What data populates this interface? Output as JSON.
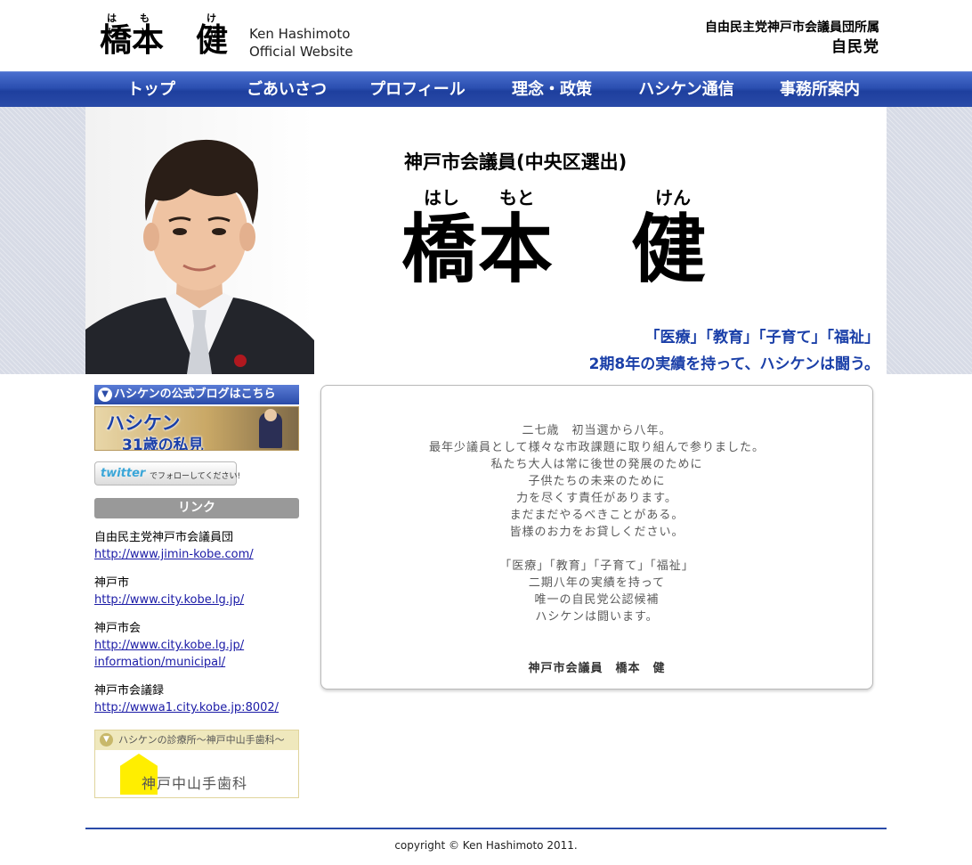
{
  "header": {
    "ruby": [
      "はし",
      "もと",
      "けん"
    ],
    "name": "橋本　健",
    "en_line1": "Ken Hashimoto",
    "en_line2": "Official Website",
    "affiliation": "自由民主党神戸市会議員団所属",
    "party": "自民党"
  },
  "nav": {
    "items": [
      {
        "label": "トップ"
      },
      {
        "label": "ごあいさつ"
      },
      {
        "label": "プロフィール"
      },
      {
        "label": "理念・政策"
      },
      {
        "label": "ハシケン通信"
      },
      {
        "label": "事務所案内"
      }
    ]
  },
  "hero": {
    "subtitle": "神戸市会議員(中央区選出)",
    "ruby": [
      "はし",
      "もと",
      "けん"
    ],
    "name": "橋本　健",
    "slogan1": "「医療」「教育」「子育て」「福祉」",
    "slogan2": "2期8年の実績を持って、ハシケンは闘う。"
  },
  "sidebar": {
    "blog_bar": "ハシケンの公式ブログはこちら",
    "blog_banner_line1": "ハシケン",
    "blog_banner_line2": "31歳の私見",
    "twitter_logo": "twitter",
    "twitter_follow": "でフォローしてください!",
    "links_heading": "リンク",
    "links": [
      {
        "name": "自由民主党神戸市会議員団",
        "url": "http://www.jimin-kobe.com/"
      },
      {
        "name": "神戸市",
        "url": "http://www.city.kobe.lg.jp/"
      },
      {
        "name": "神戸市会",
        "url": "http://www.city.kobe.lg.jp/",
        "url2": "information/municipal/"
      },
      {
        "name": "神戸市会議録",
        "url": "http://wwwa1.city.kobe.jp:8002/"
      }
    ],
    "clinic_bar": "ハシケンの診療所～神戸中山手歯科～",
    "clinic_name": "神戸中山手歯科"
  },
  "message": {
    "lines": [
      "二七歳　初当選から八年。",
      "最年少議員として様々な市政課題に取り組んで参りました。",
      "私たち大人は常に後世の発展のために",
      "子供たちの未来のために",
      "力を尽くす責任があります。",
      "まだまだやるべきことがある。",
      "皆様のお力をお貸しください。",
      "「医療」「教育」「子育て」「福祉」",
      "二期八年の実績を持って",
      "唯一の自民党公認候補",
      "ハシケンは闘います。"
    ],
    "signature": "神戸市会議員　橋本　健"
  },
  "footer": {
    "copyright": "copyright © Ken Hashimoto 2011."
  }
}
